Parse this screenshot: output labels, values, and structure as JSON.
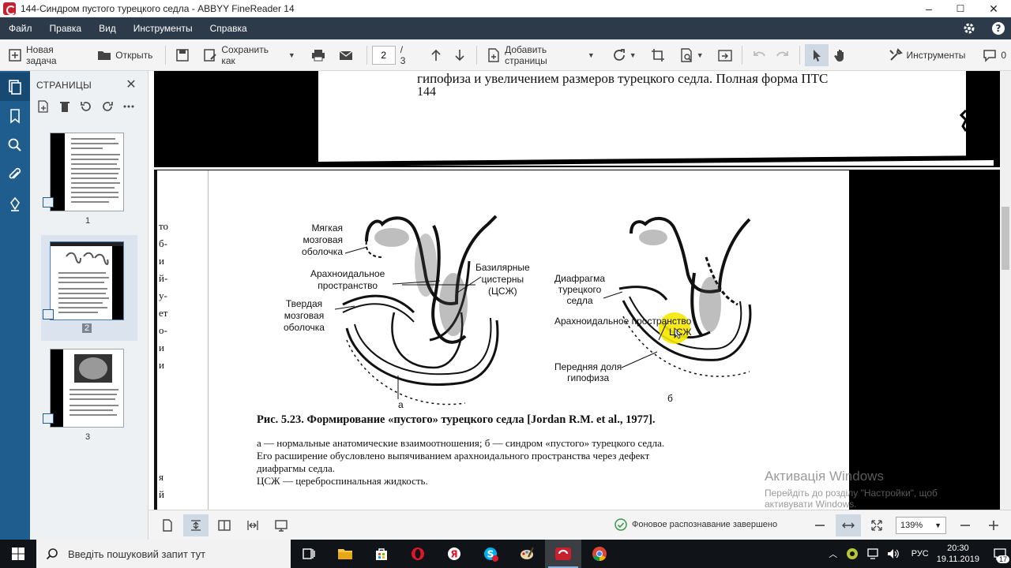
{
  "window": {
    "title": "144-Синдром пустого турецкого седла - ABBYY FineReader 14",
    "controls": {
      "minimize": "–",
      "maximize": "☐",
      "close": "✕"
    }
  },
  "menu": {
    "items": [
      "Файл",
      "Правка",
      "Вид",
      "Инструменты",
      "Справка"
    ]
  },
  "toolbar": {
    "new_task": "Новая задача",
    "open": "Открыть",
    "save_as": "Сохранить как",
    "page_current": "2",
    "page_total": "/ 3",
    "add_pages": "Добавить страницы",
    "tools": "Инструменты",
    "comments_count": "0"
  },
  "pages_panel": {
    "title": "СТРАНИЦЫ",
    "pages": [
      {
        "num": "1"
      },
      {
        "num": "2"
      },
      {
        "num": "3"
      }
    ]
  },
  "document": {
    "top_line": "гипофиза и увеличением размеров турецкого седла. Полная форма ПТС",
    "page_number": "144",
    "left_margin_chars": [
      "то",
      "б-",
      "и",
      "й-",
      "у-",
      "ет",
      "",
      "о-",
      "и",
      "и"
    ],
    "left_margin_bottom": [
      "я",
      "й"
    ],
    "labels_a": {
      "soft": [
        "Мягкая",
        "мозговая",
        "оболочка"
      ],
      "arach": [
        "Арахноидальное",
        "пространство"
      ],
      "hard": [
        "Твердая",
        "мозговая",
        "оболочка"
      ],
      "basilar": [
        "Базилярные",
        "цистерны",
        "(ЦСЖ)"
      ],
      "letter": "а"
    },
    "labels_b": {
      "diaphragm": [
        "Диафрагма",
        "турецкого",
        "седла"
      ],
      "arach": "Арахноидальное пространство",
      "csf": "ЦСЖ",
      "anterior": [
        "Передняя доля",
        "гипофиза"
      ],
      "letter": "б"
    },
    "caption_title": "Рис. 5.23. Формирование «пустого» турецкого седла [Jordan R.M. et al., 1977].",
    "caption_lines": [
      "а — нормальные анатомические взаимоотношения; б — синдром «пустого» турецкого седла.",
      "Его расширение обусловлено выпячиванием арахноидального пространства через дефект",
      "диафрагмы седла.",
      "ЦСЖ — цереброспинальная жидкость."
    ]
  },
  "statusbar": {
    "recognition_status": "Фоновое распознавание завершено",
    "zoom": "139%"
  },
  "watermark": {
    "title": "Активація Windows",
    "line1": "Перейдіть до розділу \"Настройки\", щоб",
    "line2": "активувати Windows."
  },
  "taskbar": {
    "search_placeholder": "Введіть пошуковий запит тут",
    "language": "РУС",
    "time": "20:30",
    "date": "19.11.2019",
    "notifications": "17"
  },
  "colors": {
    "menubar": "#2d3a4a",
    "rail": "#1f5d8f",
    "accent_red": "#c8202f",
    "highlight": "#f5e800"
  }
}
